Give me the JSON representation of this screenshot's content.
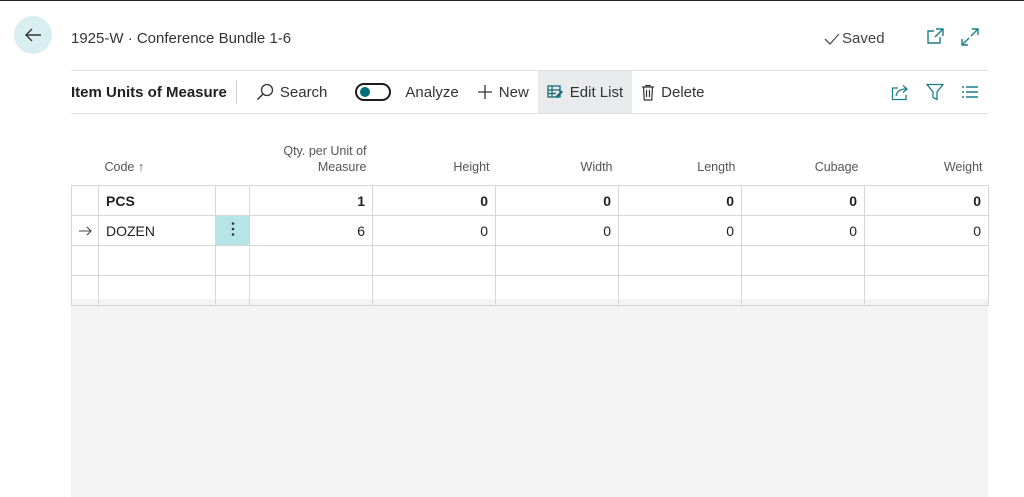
{
  "header": {
    "title": "1925-W · Conference Bundle 1-6",
    "saved_label": "Saved"
  },
  "actionbar": {
    "page_title": "Item Units of Measure",
    "search_label": "Search",
    "analyze_label": "Analyze",
    "new_label": "New",
    "edit_list_label": "Edit List",
    "delete_label": "Delete"
  },
  "table": {
    "columns": {
      "code": "Code",
      "sort_indicator": "↑",
      "qty": "Qty. per Unit of Measure",
      "height": "Height",
      "width": "Width",
      "length": "Length",
      "cubage": "Cubage",
      "weight": "Weight"
    },
    "rows": [
      {
        "code": "PCS",
        "qty": "1",
        "height": "0",
        "width": "0",
        "length": "0",
        "cubage": "0",
        "weight": "0"
      },
      {
        "code": "DOZEN",
        "qty": "6",
        "height": "0",
        "width": "0",
        "length": "0",
        "cubage": "0",
        "weight": "0"
      }
    ]
  },
  "colors": {
    "accent": "#00707a",
    "back_button_bg": "#d9eef0",
    "selected_cell": "#b7e4e7"
  },
  "icons": [
    "back-arrow-icon",
    "checkmark-icon",
    "open-new-window-icon",
    "expand-icon",
    "search-icon",
    "plus-icon",
    "edit-list-icon",
    "trash-icon",
    "share-icon",
    "filter-icon",
    "list-view-icon",
    "row-arrow-icon",
    "more-options-icon"
  ]
}
